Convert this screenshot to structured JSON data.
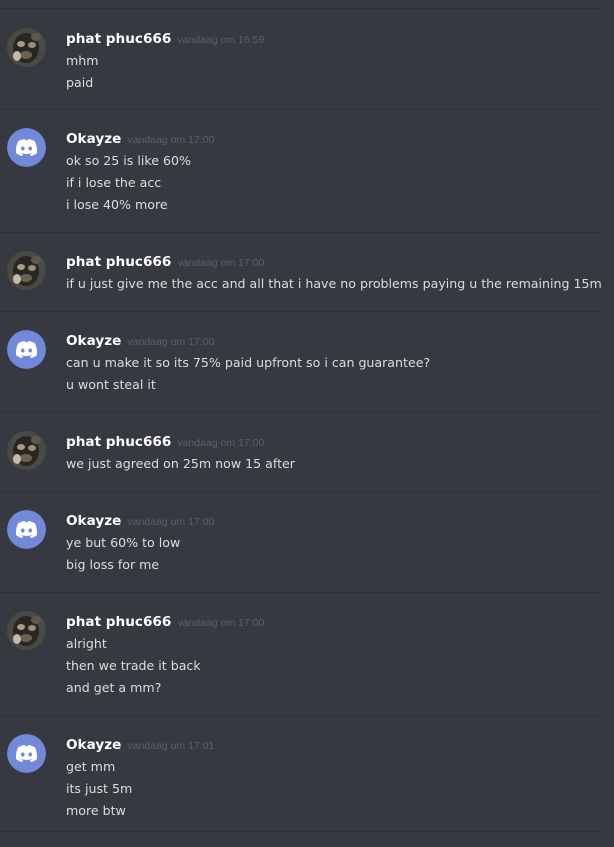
{
  "colors": {
    "background": "#36393f",
    "divider": "#2f3136",
    "username": "#ffffff",
    "timestamp": "#5d6067",
    "text": "#dcddde",
    "discord_blurple": "#7289da"
  },
  "messages": [
    {
      "author": "phat phuc666",
      "avatar": "photo-avatar",
      "timestamp": "vandaag om 16:59",
      "lines": [
        "mhm",
        "paid"
      ]
    },
    {
      "author": "Okayze",
      "avatar": "discord-logo-icon",
      "timestamp": "vandaag om 17:00",
      "lines": [
        "ok so 25 is like 60%",
        "if i lose the acc",
        "i lose 40% more"
      ]
    },
    {
      "author": "phat phuc666",
      "avatar": "photo-avatar",
      "timestamp": "vandaag om 17:00",
      "lines": [
        "if u just give me the acc and all that i have no problems paying u the remaining 15m"
      ]
    },
    {
      "author": "Okayze",
      "avatar": "discord-logo-icon",
      "timestamp": "vandaag om 17:00",
      "lines": [
        "can u make it so its 75% paid upfront so i can guarantee?",
        "u wont steal it"
      ]
    },
    {
      "author": "phat phuc666",
      "avatar": "photo-avatar",
      "timestamp": "vandaag om 17:00",
      "lines": [
        "we just agreed on 25m now 15 after"
      ]
    },
    {
      "author": "Okayze",
      "avatar": "discord-logo-icon",
      "timestamp": "vandaag om 17:00",
      "lines": [
        "ye but 60% to low",
        "big loss for me"
      ]
    },
    {
      "author": "phat phuc666",
      "avatar": "photo-avatar",
      "timestamp": "vandaag om 17:00",
      "lines": [
        "alright",
        "then we trade it back",
        "and get a mm?"
      ]
    },
    {
      "author": "Okayze",
      "avatar": "discord-logo-icon",
      "timestamp": "vandaag om 17:01",
      "lines": [
        "get mm",
        "its just 5m",
        "more btw"
      ]
    }
  ]
}
